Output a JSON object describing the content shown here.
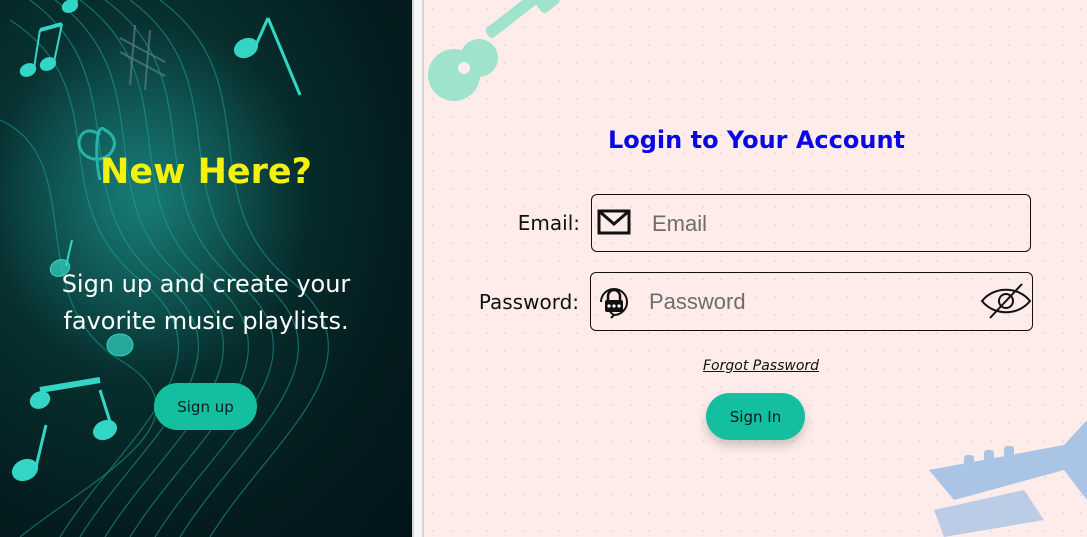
{
  "left_panel": {
    "heading": "New Here?",
    "description": "Sign up and create your favorite music playlists.",
    "signup_label": "Sign up"
  },
  "login": {
    "title": "Login to Your Account",
    "email_label": "Email:",
    "email_placeholder": "Email",
    "email_value": "",
    "password_label": "Password:",
    "password_placeholder": "Password",
    "password_value": "",
    "forgot_label": "Forgot Password",
    "signin_label": "Sign In"
  },
  "icons": {
    "email": "envelope-icon",
    "password": "padlock-icon",
    "visibility": "eye-slash-icon"
  },
  "colors": {
    "accent": "#13bf9f",
    "heading_yellow": "#f5f10f",
    "title_blue": "#0b06e6",
    "right_bg": "#fdecea"
  }
}
